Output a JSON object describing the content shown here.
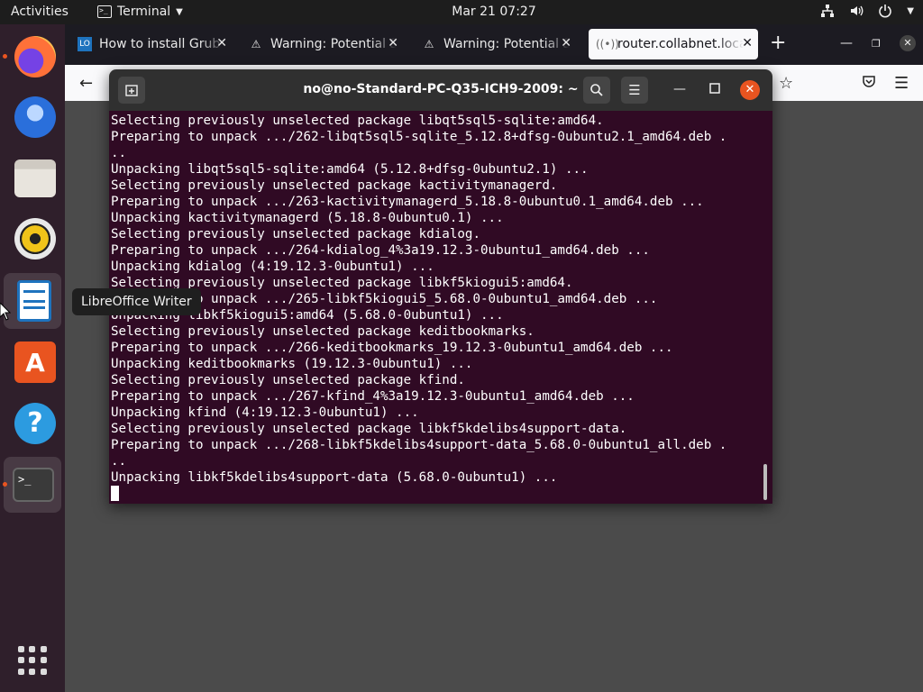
{
  "topbar": {
    "activities": "Activities",
    "app_name": "Terminal",
    "clock": "Mar 21  07:27"
  },
  "dock": {
    "items": [
      {
        "name": "Firefox",
        "color": "#ff7139"
      },
      {
        "name": "Thunderbird",
        "color": "#2a6fdb"
      },
      {
        "name": "Files",
        "color": "#c8c4bd"
      },
      {
        "name": "Rhythmbox",
        "color": "#f0c419"
      },
      {
        "name": "LibreOffice Writer",
        "color": "#1e73be"
      },
      {
        "name": "Ubuntu Software",
        "color": "#e95420"
      },
      {
        "name": "Help",
        "color": "#2c9be0"
      },
      {
        "name": "Terminal",
        "color": "#3a3a3a"
      }
    ]
  },
  "tooltip": "LibreOffice Writer",
  "browser": {
    "tabs": [
      {
        "title": "How to install Grub C",
        "icon": "LO"
      },
      {
        "title": "Warning: Potential Se",
        "icon": "warning-icon"
      },
      {
        "title": "Warning: Potential Se",
        "icon": "warning-icon"
      },
      {
        "title": "router.collabnet.loca",
        "icon": "wifi-icon"
      }
    ],
    "new_tab": "+"
  },
  "terminal": {
    "title": "no@no-Standard-PC-Q35-ICH9-2009: ~",
    "lines": [
      "Selecting previously unselected package libqt5sql5-sqlite:amd64.",
      "Preparing to unpack .../262-libqt5sql5-sqlite_5.12.8+dfsg-0ubuntu2.1_amd64.deb .",
      "..",
      "Unpacking libqt5sql5-sqlite:amd64 (5.12.8+dfsg-0ubuntu2.1) ...",
      "Selecting previously unselected package kactivitymanagerd.",
      "Preparing to unpack .../263-kactivitymanagerd_5.18.8-0ubuntu0.1_amd64.deb ...",
      "Unpacking kactivitymanagerd (5.18.8-0ubuntu0.1) ...",
      "Selecting previously unselected package kdialog.",
      "Preparing to unpack .../264-kdialog_4%3a19.12.3-0ubuntu1_amd64.deb ...",
      "Unpacking kdialog (4:19.12.3-0ubuntu1) ...",
      "Selecting previously unselected package libkf5kiogui5:amd64.",
      "Preparing to unpack .../265-libkf5kiogui5_5.68.0-0ubuntu1_amd64.deb ...",
      "Unpacking libkf5kiogui5:amd64 (5.68.0-0ubuntu1) ...",
      "Selecting previously unselected package keditbookmarks.",
      "Preparing to unpack .../266-keditbookmarks_19.12.3-0ubuntu1_amd64.deb ...",
      "Unpacking keditbookmarks (19.12.3-0ubuntu1) ...",
      "Selecting previously unselected package kfind.",
      "Preparing to unpack .../267-kfind_4%3a19.12.3-0ubuntu1_amd64.deb ...",
      "Unpacking kfind (4:19.12.3-0ubuntu1) ...",
      "Selecting previously unselected package libkf5kdelibs4support-data.",
      "Preparing to unpack .../268-libkf5kdelibs4support-data_5.68.0-0ubuntu1_all.deb .",
      "..",
      "Unpacking libkf5kdelibs4support-data (5.68.0-0ubuntu1) ..."
    ]
  },
  "colors": {
    "terminal_bg": "#300a24",
    "ubuntu_orange": "#e95420",
    "dock_bg": "#2f1f2b"
  }
}
